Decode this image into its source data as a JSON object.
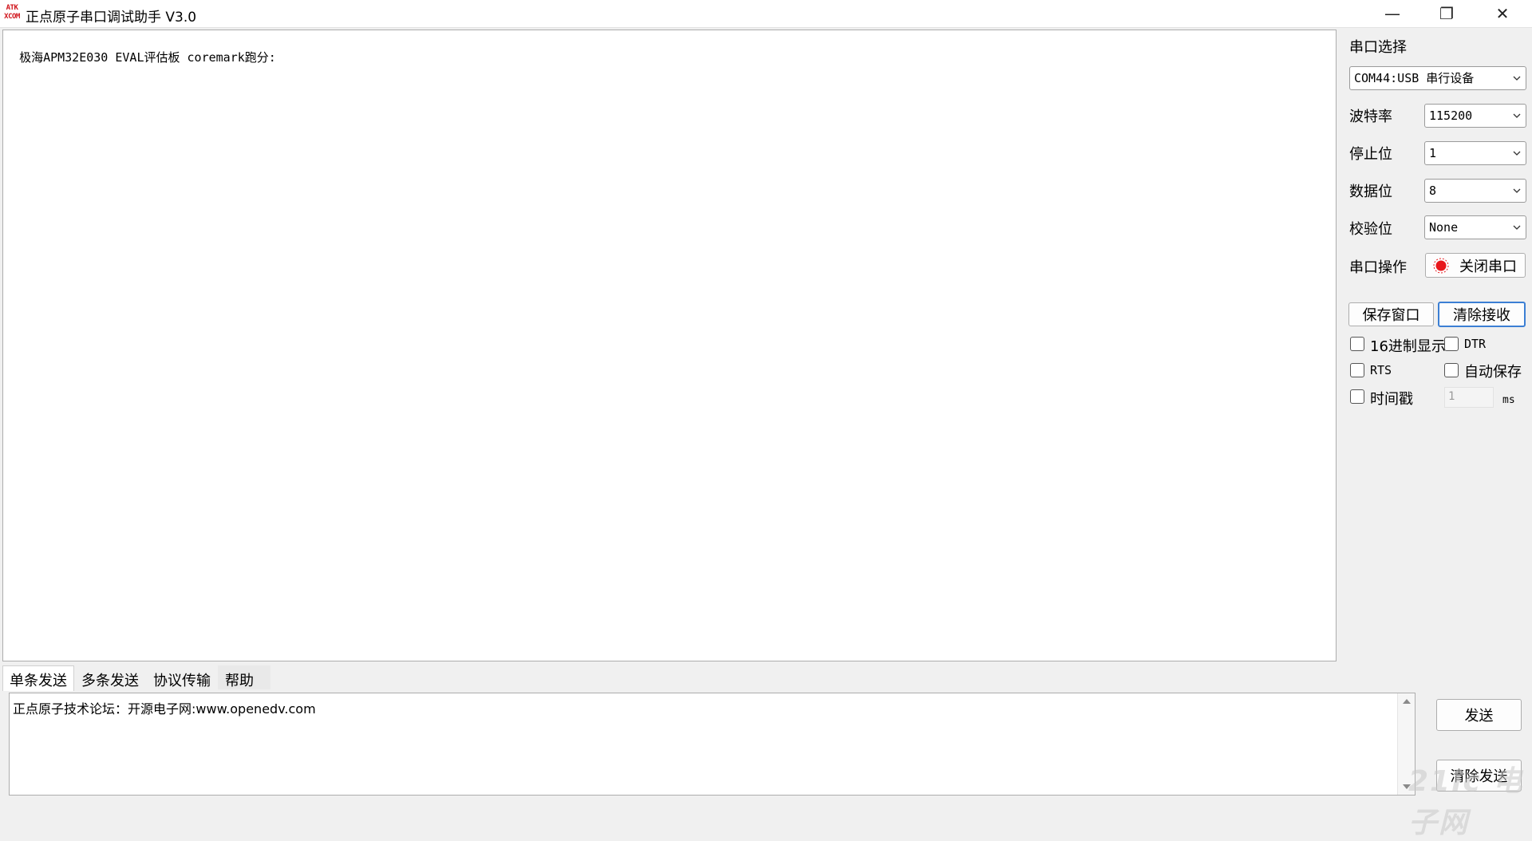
{
  "window": {
    "logo_text_top": "ATK",
    "logo_text_bottom": "XCOM",
    "title": "正点原子串口调试助手 V3.0",
    "minimize_glyph": "—",
    "maximize_glyph": "❐",
    "close_glyph": "✕"
  },
  "receive": {
    "text": "极海APM32E030 EVAL评估板 coremark跑分:"
  },
  "panel": {
    "port_select_label": "串口选择",
    "port_value": "COM44:USB 串行设备",
    "baud_label": "波特率",
    "baud_value": "115200",
    "stopbits_label": "停止位",
    "stopbits_value": "1",
    "databits_label": "数据位",
    "databits_value": "8",
    "parity_label": "校验位",
    "parity_value": "None",
    "port_op_label": "串口操作",
    "close_port_label": "关闭串口",
    "save_window_label": "保存窗口",
    "clear_receive_label": "清除接收",
    "hex_display_label": "16进制显示",
    "dtr_label": "DTR",
    "rts_label": "RTS",
    "auto_save_label": "自动保存",
    "timestamp_label": "时间戳",
    "timestamp_value": "1",
    "timestamp_unit": "ms"
  },
  "tabs": [
    {
      "label": "单条发送"
    },
    {
      "label": "多条发送"
    },
    {
      "label": "协议传输"
    },
    {
      "label": "帮助"
    }
  ],
  "send": {
    "text": "正点原子技术论坛：开源电子网:www.openedv.com",
    "send_button_label": "发送",
    "clear_send_label": "清除发送"
  },
  "watermark": "21ic 电子网",
  "colors": {
    "accent_focus": "#3c7fd4",
    "port_open_indicator": "#e8161b"
  }
}
